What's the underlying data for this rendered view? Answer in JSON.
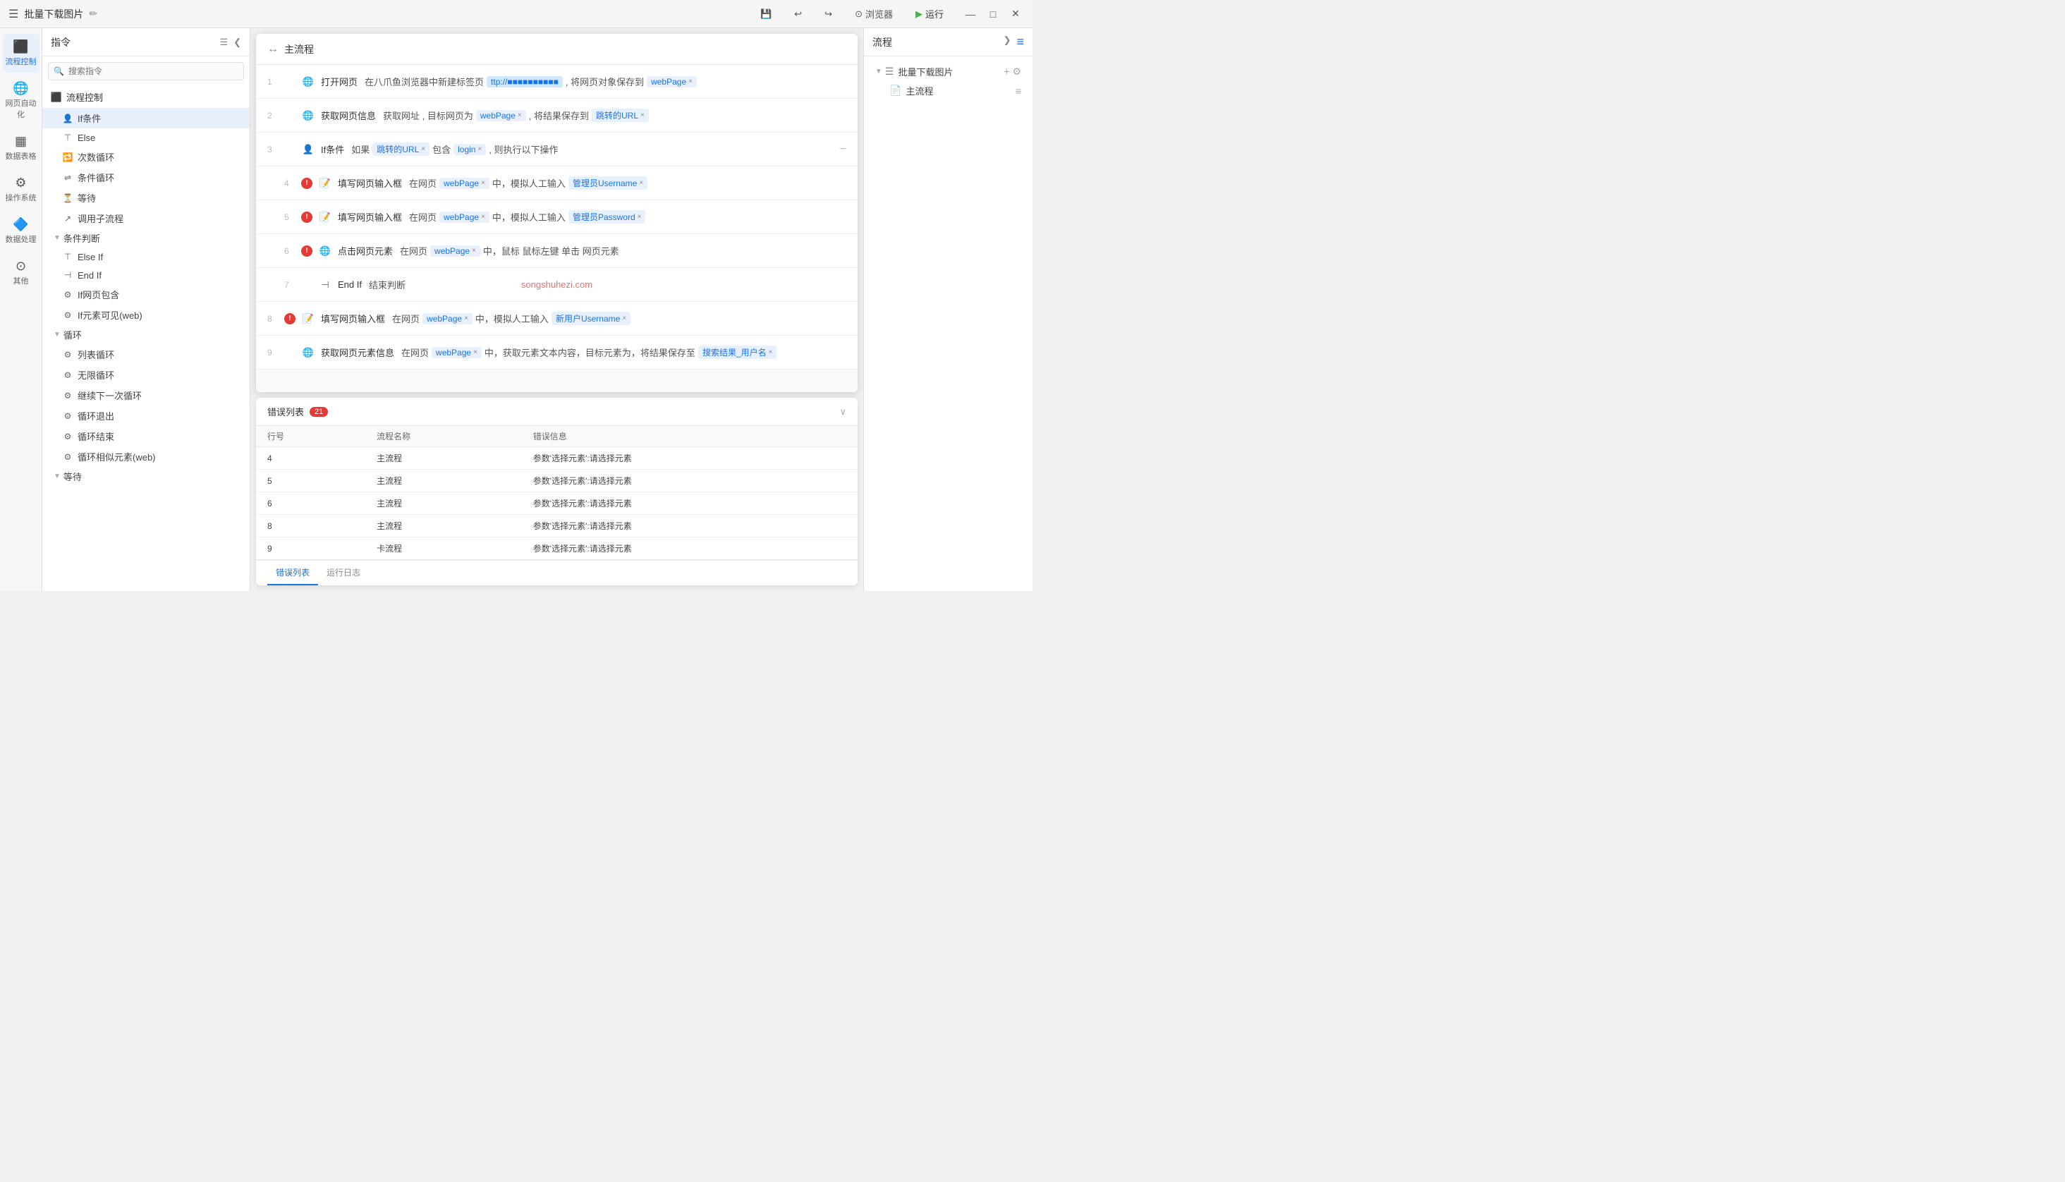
{
  "titleBar": {
    "logo": "☰",
    "title": "批量下载图片",
    "editIcon": "✏",
    "saveLabel": "💾",
    "undoLabel": "↩",
    "redoLabel": "↪",
    "browserLabel": "浏览器",
    "runLabel": "运行",
    "minimizeLabel": "—",
    "maximizeLabel": "□",
    "closeLabel": "✕"
  },
  "leftNav": {
    "items": [
      {
        "id": "flow-control",
        "icon": "⬛",
        "label": "流程控制",
        "active": true
      },
      {
        "id": "web-auto",
        "icon": "🌐",
        "label": "网页自动化"
      },
      {
        "id": "data-table",
        "icon": "📊",
        "label": "数据表格"
      },
      {
        "id": "operation-sys",
        "icon": "⚙",
        "label": "操作系统"
      },
      {
        "id": "data-process",
        "icon": "🔧",
        "label": "数据处理"
      },
      {
        "id": "others",
        "icon": "⋯",
        "label": "其他"
      }
    ]
  },
  "instructionPanel": {
    "title": "指令",
    "searchPlaceholder": "搜索指令",
    "sections": [
      {
        "id": "flow-control",
        "label": "流程控制",
        "active": true,
        "items": [
          {
            "id": "if-condition",
            "label": "If条件"
          },
          {
            "id": "else",
            "label": "Else"
          },
          {
            "id": "count-loop",
            "label": "次数循环"
          },
          {
            "id": "cond-loop",
            "label": "条件循环"
          },
          {
            "id": "wait",
            "label": "等待"
          },
          {
            "id": "call-subflow",
            "label": "调用子流程"
          }
        ],
        "subsections": [
          {
            "label": "条件判断",
            "items": [
              {
                "id": "else-if",
                "label": "Else If"
              },
              {
                "id": "end-if",
                "label": "End If"
              },
              {
                "id": "if-page-contains",
                "label": "If网页包含"
              },
              {
                "id": "if-element-visible",
                "label": "If元素可见(web)"
              }
            ]
          },
          {
            "label": "循环",
            "items": [
              {
                "id": "list-loop",
                "label": "列表循环"
              },
              {
                "id": "infinite-loop",
                "label": "无限循环"
              },
              {
                "id": "continue-loop",
                "label": "继续下一次循环"
              },
              {
                "id": "loop-exit",
                "label": "循环退出"
              },
              {
                "id": "loop-end",
                "label": "循环结束"
              },
              {
                "id": "loop-similar-web",
                "label": "循环相似元素(web)"
              }
            ]
          },
          {
            "label": "等待",
            "items": []
          }
        ]
      }
    ]
  },
  "flowWindow": {
    "icon": "↔",
    "title": "主流程",
    "rows": [
      {
        "num": "1",
        "hasError": false,
        "indent": 0,
        "icon": "🌐",
        "action": "打开网页",
        "content": "在八爪鱼浏览器中新建标签页  ttp://■■■■■■■■■■■  , 将网页对象保存到",
        "tag1": "webPage",
        "hasMinus": false
      },
      {
        "num": "2",
        "hasError": false,
        "indent": 0,
        "icon": "🌐",
        "action": "获取网页信息",
        "content": "获取网址 , 目标网页为",
        "tag1": "webPage",
        "content2": ", 将结果保存到",
        "tag2": "跳转的URL",
        "hasMinus": false
      },
      {
        "num": "3",
        "hasError": false,
        "indent": 0,
        "icon": "👤",
        "action": "If条件",
        "content": "如果",
        "tag1": "跳转的URL",
        "content2": "包含",
        "tag2": "login",
        "content3": ", 则执行以下操作",
        "hasMinus": true
      },
      {
        "num": "4",
        "hasError": true,
        "indent": 1,
        "icon": "📝",
        "action": "填写网页输入框",
        "content": "在网页",
        "tag1": "webPage",
        "content2": "中，模拟人工输入",
        "tag2": "管理员Username",
        "hasMinus": false
      },
      {
        "num": "5",
        "hasError": true,
        "indent": 1,
        "icon": "📝",
        "action": "填写网页输入框",
        "content": "在网页",
        "tag1": "webPage",
        "content2": "中，模拟人工输入",
        "tag2": "管理员Password",
        "hasMinus": false
      },
      {
        "num": "6",
        "hasError": true,
        "indent": 1,
        "icon": "🖱",
        "action": "点击网页元素",
        "content": "在网页",
        "tag1": "webPage",
        "content2": "中，鼠标 鼠标左键 单击 网页元素",
        "hasMinus": false
      },
      {
        "num": "7",
        "hasError": false,
        "indent": 1,
        "isEndIf": true,
        "action": "End If",
        "content": "结束判断",
        "watermark": "songshuhezi.com",
        "hasMinus": false
      },
      {
        "num": "8",
        "hasError": true,
        "indent": 0,
        "icon": "📝",
        "action": "填写网页输入框",
        "content": "在网页",
        "tag1": "webPage",
        "content2": "中，模拟人工输入",
        "tag2": "新用户Username",
        "hasMinus": false
      },
      {
        "num": "9",
        "hasError": false,
        "indent": 0,
        "icon": "🌐",
        "action": "获取网页元素信息",
        "content": "在网页",
        "tag1": "webPage",
        "content2": "中，获取元素文本内容，目标元素为，将结果保存至",
        "tag2": "搜索结果_用户名",
        "hasMinus": false
      }
    ]
  },
  "errorPanel": {
    "title": "错误列表",
    "count": "21",
    "columns": [
      "行号",
      "流程名称",
      "错误信息"
    ],
    "rows": [
      {
        "line": "4",
        "flow": "主流程",
        "error": "参数'选择元素':请选择元素"
      },
      {
        "line": "5",
        "flow": "主流程",
        "error": "参数'选择元素':请选择元素"
      },
      {
        "line": "6",
        "flow": "主流程",
        "error": "参数'选择元素':请选择元素"
      },
      {
        "line": "8",
        "flow": "主流程",
        "error": "参数'选择元素':请选择元素"
      },
      {
        "line": "9",
        "flow": "卡流程",
        "error": "参数'选择元素':请选择元素"
      }
    ],
    "tabs": [
      "错误列表",
      "运行日志"
    ]
  },
  "rightPanel": {
    "title": "流程",
    "addIcon": "+",
    "settingsIcon": "≡",
    "tree": {
      "rootLabel": "批量下载图片",
      "children": [
        {
          "label": "主流程"
        }
      ]
    }
  }
}
